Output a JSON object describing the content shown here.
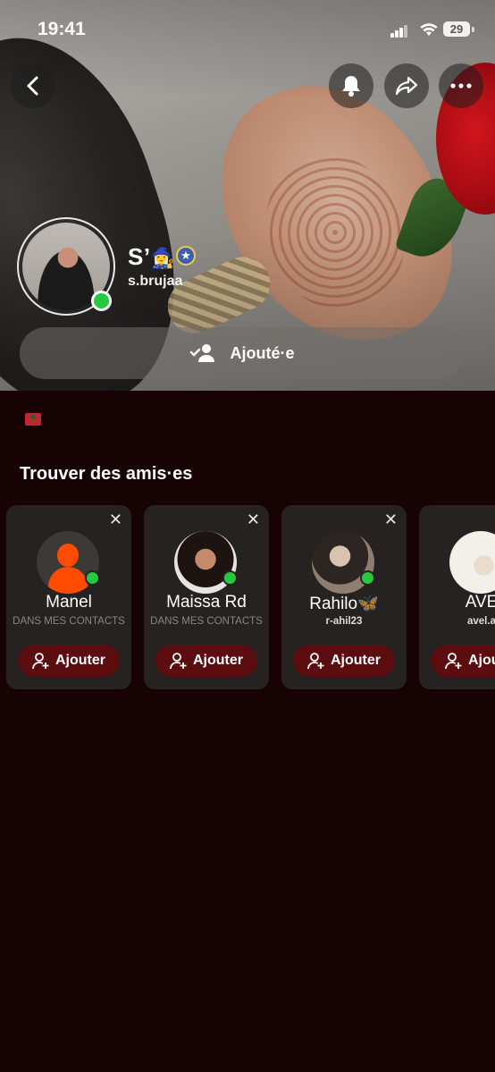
{
  "status_bar": {
    "time": "19:41",
    "battery": "29"
  },
  "header": {
    "back_icon": "chevron-left-icon",
    "actions": [
      "bell-icon",
      "share-icon",
      "more-icon"
    ]
  },
  "profile": {
    "display_name": "S’",
    "name_emoji": "🧙‍♀️",
    "username": "s.brujaa",
    "added_button_label": "Ajouté·e",
    "online_color": "#26c940"
  },
  "flag": "🇲🇦",
  "find_friends": {
    "title": "Trouver des amis·es",
    "add_label": "Ajouter",
    "cards": [
      {
        "name": "Manel",
        "subtitle": "DANS MES CONTACTS"
      },
      {
        "name": "Maissa Rd",
        "subtitle": "DANS MES CONTACTS"
      },
      {
        "name": "Rahilo🦋",
        "subtitle": "r-ahil23"
      },
      {
        "name": "AVE",
        "subtitle": "avel.a"
      }
    ]
  },
  "colors": {
    "background": "#170304",
    "card": "#262222",
    "add_button": "#5c0d10"
  }
}
